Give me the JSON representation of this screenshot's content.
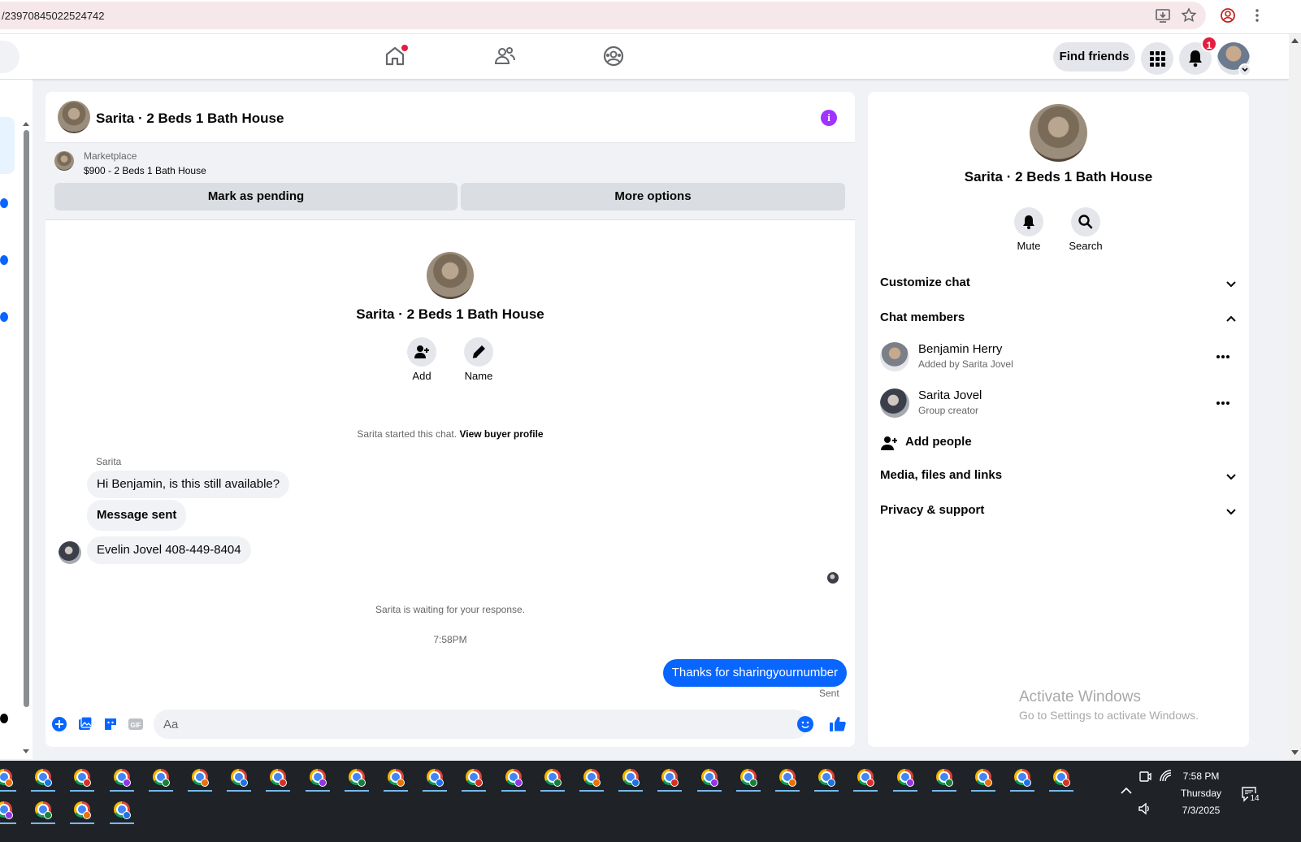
{
  "browser": {
    "url": "/23970845022524742"
  },
  "nav": {
    "find_friends": "Find friends",
    "notif_count": "1"
  },
  "chat": {
    "header_title": "Sarita · 2 Beds 1 Bath House",
    "marketplace_label": "Marketplace",
    "listing": "$900 - 2 Beds 1 Bath House",
    "mark_pending": "Mark as pending",
    "more_options": "More options",
    "center_title": "Sarita · 2 Beds 1 Bath House",
    "add_label": "Add",
    "name_label": "Name",
    "started_note": "Sarita started this chat.",
    "view_buyer_profile": "View buyer profile",
    "sender_name": "Sarita",
    "messages_in": [
      "Hi Benjamin, is this still available?",
      "Message sent",
      "Evelin Jovel 408-449-8404"
    ],
    "waiting_note": "Sarita is waiting for your response.",
    "time_note": "7:58PM",
    "message_out": "Thanks for sharingyournumber",
    "sent_status": "Sent",
    "composer_placeholder": "Aa"
  },
  "details": {
    "title": "Sarita · 2 Beds 1 Bath House",
    "mute_label": "Mute",
    "search_label": "Search",
    "customize_chat": "Customize chat",
    "chat_members": "Chat members",
    "members": [
      {
        "name": "Benjamin Herry",
        "sub": "Added by Sarita Jovel"
      },
      {
        "name": "Sarita Jovel",
        "sub": "Group creator"
      }
    ],
    "add_people": "Add people",
    "media_files_links": "Media, files and links",
    "privacy_support": "Privacy & support"
  },
  "watermark": {
    "line1": "Activate Windows",
    "line2": "Go to Settings to activate Windows."
  },
  "taskbar": {
    "time": "7:58 PM",
    "day": "Thursday",
    "date": "7/3/2025",
    "notif_count": "14"
  },
  "colors": {
    "accent": "#0866ff",
    "badge": "#e41e3f",
    "info": "#a033ff"
  }
}
